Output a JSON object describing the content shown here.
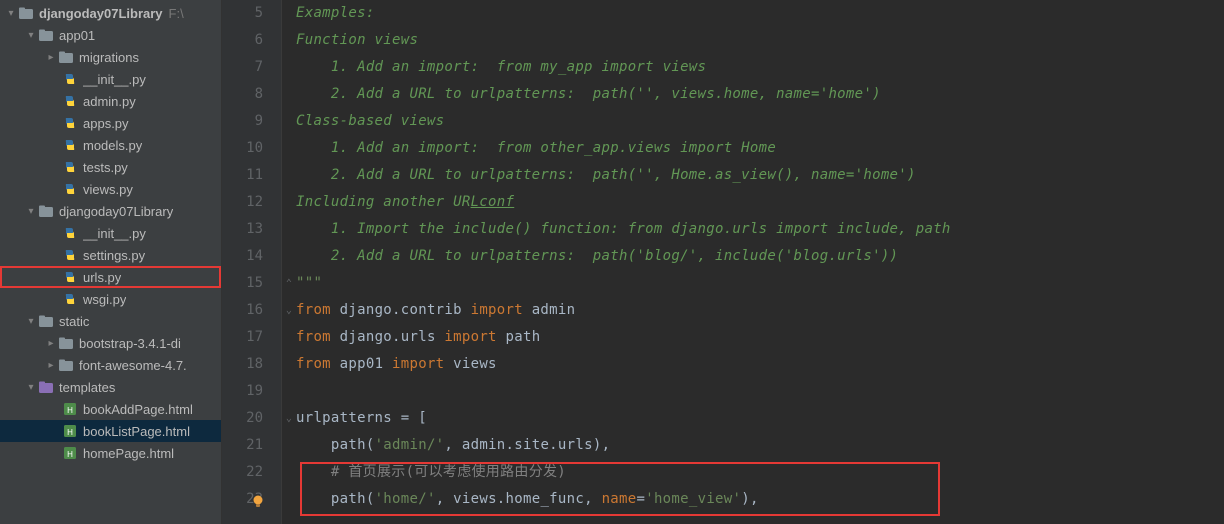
{
  "sidebar": {
    "project": {
      "name": "djangoday07Library",
      "path": "F:\\"
    },
    "items": [
      {
        "label": "app01",
        "type": "dir",
        "expanded": true,
        "indent": 20
      },
      {
        "label": "migrations",
        "type": "dir",
        "expanded": false,
        "indent": 40,
        "hasArrow": true
      },
      {
        "label": "__init__.py",
        "type": "py",
        "indent": 58
      },
      {
        "label": "admin.py",
        "type": "py",
        "indent": 58
      },
      {
        "label": "apps.py",
        "type": "py",
        "indent": 58
      },
      {
        "label": "models.py",
        "type": "py",
        "indent": 58
      },
      {
        "label": "tests.py",
        "type": "py",
        "indent": 58
      },
      {
        "label": "views.py",
        "type": "py",
        "indent": 58
      },
      {
        "label": "djangoday07Library",
        "type": "dir",
        "expanded": true,
        "indent": 20
      },
      {
        "label": "__init__.py",
        "type": "py",
        "indent": 58
      },
      {
        "label": "settings.py",
        "type": "py",
        "indent": 58
      },
      {
        "label": "urls.py",
        "type": "py",
        "indent": 58,
        "highlight": true
      },
      {
        "label": "wsgi.py",
        "type": "py",
        "indent": 58
      },
      {
        "label": "static",
        "type": "dir",
        "expanded": true,
        "indent": 20
      },
      {
        "label": "bootstrap-3.4.1-di",
        "type": "dir",
        "expanded": false,
        "indent": 40,
        "hasArrow": true
      },
      {
        "label": "font-awesome-4.7.",
        "type": "dir",
        "expanded": false,
        "indent": 40,
        "hasArrow": true
      },
      {
        "label": "templates",
        "type": "tpldir",
        "expanded": true,
        "indent": 20
      },
      {
        "label": "bookAddPage.html",
        "type": "html",
        "indent": 58
      },
      {
        "label": "bookListPage.html",
        "type": "html",
        "indent": 58,
        "selected": true
      },
      {
        "label": "homePage.html",
        "type": "html",
        "indent": 58
      }
    ]
  },
  "gutter": {
    "start": 5,
    "end": 23,
    "bulbLine": 23
  },
  "code": {
    "lines": [
      {
        "n": 5,
        "seg": [
          [
            "c-comment",
            "Examples:"
          ]
        ]
      },
      {
        "n": 6,
        "seg": [
          [
            "c-comment",
            "Function views"
          ]
        ]
      },
      {
        "n": 7,
        "seg": [
          [
            "c-comment",
            "    1. Add an import:  from my_app import views"
          ]
        ]
      },
      {
        "n": 8,
        "seg": [
          [
            "c-comment",
            "    2. Add a URL to urlpatterns:  path('', views.home, name='home')"
          ]
        ]
      },
      {
        "n": 9,
        "seg": [
          [
            "c-comment",
            "Class-based views"
          ]
        ]
      },
      {
        "n": 10,
        "seg": [
          [
            "c-comment",
            "    1. Add an import:  from other_app.views import Home"
          ]
        ]
      },
      {
        "n": 11,
        "seg": [
          [
            "c-comment",
            "    2. Add a URL to urlpatterns:  path('', Home.as_view(), name='home')"
          ]
        ]
      },
      {
        "n": 12,
        "seg": [
          [
            "c-comment",
            "Including another UR"
          ],
          [
            "c-comment underline",
            "Lconf"
          ]
        ]
      },
      {
        "n": 13,
        "seg": [
          [
            "c-comment",
            "    1. Import the include() function: from django.urls import include, path"
          ]
        ]
      },
      {
        "n": 14,
        "seg": [
          [
            "c-comment",
            "    2. Add a URL to urlpatterns:  path('blog/', include('blog.urls'))"
          ]
        ]
      },
      {
        "n": 15,
        "seg": [
          [
            "c-str",
            "\"\"\""
          ]
        ],
        "noItalic": true,
        "fold": "up"
      },
      {
        "n": 16,
        "seg": [
          [
            "c-kw",
            "from "
          ],
          [
            "c-ident",
            "django.contrib "
          ],
          [
            "c-kw",
            "import "
          ],
          [
            "c-ident",
            "admin"
          ]
        ],
        "noItalic": true,
        "fold": "down"
      },
      {
        "n": 17,
        "seg": [
          [
            "c-kw",
            "from "
          ],
          [
            "c-ident",
            "django.urls "
          ],
          [
            "c-kw",
            "import "
          ],
          [
            "c-ident",
            "path"
          ]
        ],
        "noItalic": true
      },
      {
        "n": 18,
        "seg": [
          [
            "c-kw",
            "from "
          ],
          [
            "c-ident",
            "app01 "
          ],
          [
            "c-kw",
            "import "
          ],
          [
            "c-ident",
            "views"
          ]
        ],
        "noItalic": true
      },
      {
        "n": 19,
        "seg": [],
        "noItalic": true
      },
      {
        "n": 20,
        "seg": [
          [
            "c-ident",
            "urlpatterns = ["
          ]
        ],
        "noItalic": true,
        "fold": "down"
      },
      {
        "n": 21,
        "seg": [
          [
            "c-ident",
            "    "
          ],
          [
            "c-ident",
            "path("
          ],
          [
            "c-str",
            "'admin/'"
          ],
          [
            "c-op",
            ", "
          ],
          [
            "c-ident",
            "admin.site.urls)"
          ],
          [
            "c-op",
            ","
          ]
        ],
        "noItalic": true
      },
      {
        "n": 22,
        "seg": [
          [
            "c-ident",
            "    "
          ],
          [
            "c-hash",
            "# 首页展示(可以考虑使用路由分发)"
          ]
        ],
        "noItalic": true
      },
      {
        "n": 23,
        "seg": [
          [
            "c-ident",
            "    "
          ],
          [
            "c-ident",
            "path("
          ],
          [
            "c-str",
            "'home/'"
          ],
          [
            "c-op",
            ", "
          ],
          [
            "c-ident",
            "views.home_func"
          ],
          [
            "c-op",
            ", "
          ],
          [
            "c-kw",
            "name"
          ],
          [
            "c-op",
            "="
          ],
          [
            "c-str",
            "'home_view'"
          ],
          [
            "c-ident",
            ")"
          ],
          [
            "c-op",
            ","
          ]
        ],
        "noItalic": true
      }
    ]
  }
}
